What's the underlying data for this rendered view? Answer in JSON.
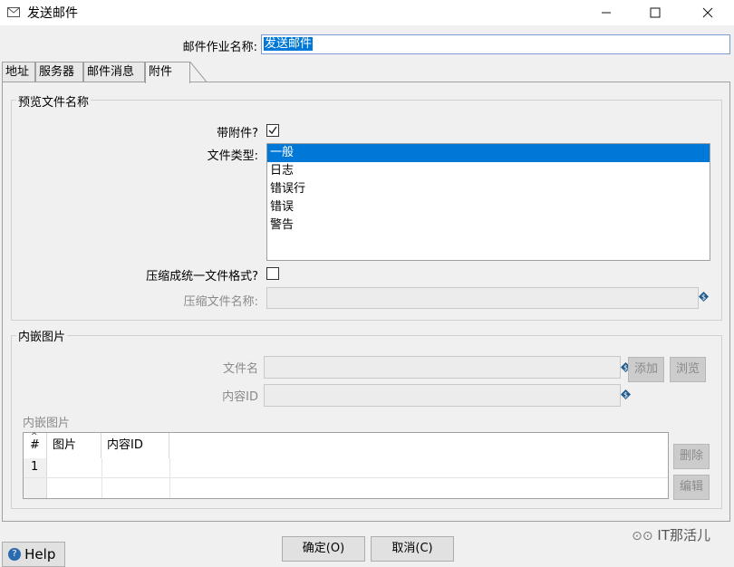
{
  "window": {
    "title": "发送邮件",
    "icon": "mail-icon",
    "minimize": "—",
    "maximize": "☐",
    "close": "✕"
  },
  "job": {
    "label": "邮件作业名称:",
    "value": "发送邮件"
  },
  "tabs": [
    {
      "label": "地址"
    },
    {
      "label": "服务器"
    },
    {
      "label": "邮件消息"
    },
    {
      "label": "附件"
    }
  ],
  "preview": {
    "legend": "预览文件名称",
    "attach_label": "带附件?",
    "attach_checked": true,
    "filetype_label": "文件类型:",
    "filetypes": [
      "一般",
      "日志",
      "错误行",
      "错误",
      "警告"
    ],
    "selected_filetype": "一般",
    "compress_label": "压缩成统一文件格式?",
    "compress_checked": false,
    "zipname_label": "压缩文件名称:",
    "zipname_value": ""
  },
  "embedded": {
    "legend": "内嵌图片",
    "filename_label": "文件名",
    "contentid_label": "内容ID",
    "add_button": "添加",
    "browse_button": "浏览",
    "table_title": "内嵌图片",
    "columns": [
      "#",
      "图片",
      "内容ID"
    ],
    "rows": [
      {
        "num": "1",
        "image": "",
        "content_id": ""
      }
    ],
    "delete_button": "删除",
    "edit_button": "编辑"
  },
  "footer": {
    "ok_button": "确定(O)",
    "cancel_button": "取消(C)",
    "help_button": "Help"
  },
  "watermark": "IT那活儿"
}
